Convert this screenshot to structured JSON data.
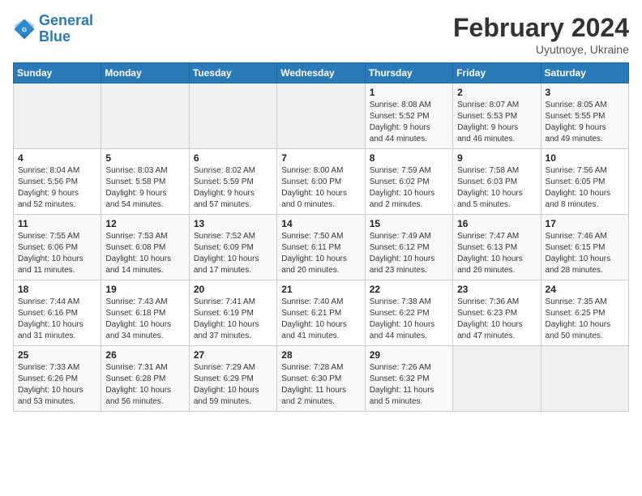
{
  "header": {
    "logo_line1": "General",
    "logo_line2": "Blue",
    "month_title": "February 2024",
    "location": "Uyutnoye, Ukraine"
  },
  "days_of_week": [
    "Sunday",
    "Monday",
    "Tuesday",
    "Wednesday",
    "Thursday",
    "Friday",
    "Saturday"
  ],
  "weeks": [
    [
      {
        "day": "",
        "info": ""
      },
      {
        "day": "",
        "info": ""
      },
      {
        "day": "",
        "info": ""
      },
      {
        "day": "",
        "info": ""
      },
      {
        "day": "1",
        "info": "Sunrise: 8:08 AM\nSunset: 5:52 PM\nDaylight: 9 hours\nand 44 minutes."
      },
      {
        "day": "2",
        "info": "Sunrise: 8:07 AM\nSunset: 5:53 PM\nDaylight: 9 hours\nand 46 minutes."
      },
      {
        "day": "3",
        "info": "Sunrise: 8:05 AM\nSunset: 5:55 PM\nDaylight: 9 hours\nand 49 minutes."
      }
    ],
    [
      {
        "day": "4",
        "info": "Sunrise: 8:04 AM\nSunset: 5:56 PM\nDaylight: 9 hours\nand 52 minutes."
      },
      {
        "day": "5",
        "info": "Sunrise: 8:03 AM\nSunset: 5:58 PM\nDaylight: 9 hours\nand 54 minutes."
      },
      {
        "day": "6",
        "info": "Sunrise: 8:02 AM\nSunset: 5:59 PM\nDaylight: 9 hours\nand 57 minutes."
      },
      {
        "day": "7",
        "info": "Sunrise: 8:00 AM\nSunset: 6:00 PM\nDaylight: 10 hours\nand 0 minutes."
      },
      {
        "day": "8",
        "info": "Sunrise: 7:59 AM\nSunset: 6:02 PM\nDaylight: 10 hours\nand 2 minutes."
      },
      {
        "day": "9",
        "info": "Sunrise: 7:58 AM\nSunset: 6:03 PM\nDaylight: 10 hours\nand 5 minutes."
      },
      {
        "day": "10",
        "info": "Sunrise: 7:56 AM\nSunset: 6:05 PM\nDaylight: 10 hours\nand 8 minutes."
      }
    ],
    [
      {
        "day": "11",
        "info": "Sunrise: 7:55 AM\nSunset: 6:06 PM\nDaylight: 10 hours\nand 11 minutes."
      },
      {
        "day": "12",
        "info": "Sunrise: 7:53 AM\nSunset: 6:08 PM\nDaylight: 10 hours\nand 14 minutes."
      },
      {
        "day": "13",
        "info": "Sunrise: 7:52 AM\nSunset: 6:09 PM\nDaylight: 10 hours\nand 17 minutes."
      },
      {
        "day": "14",
        "info": "Sunrise: 7:50 AM\nSunset: 6:11 PM\nDaylight: 10 hours\nand 20 minutes."
      },
      {
        "day": "15",
        "info": "Sunrise: 7:49 AM\nSunset: 6:12 PM\nDaylight: 10 hours\nand 23 minutes."
      },
      {
        "day": "16",
        "info": "Sunrise: 7:47 AM\nSunset: 6:13 PM\nDaylight: 10 hours\nand 26 minutes."
      },
      {
        "day": "17",
        "info": "Sunrise: 7:46 AM\nSunset: 6:15 PM\nDaylight: 10 hours\nand 28 minutes."
      }
    ],
    [
      {
        "day": "18",
        "info": "Sunrise: 7:44 AM\nSunset: 6:16 PM\nDaylight: 10 hours\nand 31 minutes."
      },
      {
        "day": "19",
        "info": "Sunrise: 7:43 AM\nSunset: 6:18 PM\nDaylight: 10 hours\nand 34 minutes."
      },
      {
        "day": "20",
        "info": "Sunrise: 7:41 AM\nSunset: 6:19 PM\nDaylight: 10 hours\nand 37 minutes."
      },
      {
        "day": "21",
        "info": "Sunrise: 7:40 AM\nSunset: 6:21 PM\nDaylight: 10 hours\nand 41 minutes."
      },
      {
        "day": "22",
        "info": "Sunrise: 7:38 AM\nSunset: 6:22 PM\nDaylight: 10 hours\nand 44 minutes."
      },
      {
        "day": "23",
        "info": "Sunrise: 7:36 AM\nSunset: 6:23 PM\nDaylight: 10 hours\nand 47 minutes."
      },
      {
        "day": "24",
        "info": "Sunrise: 7:35 AM\nSunset: 6:25 PM\nDaylight: 10 hours\nand 50 minutes."
      }
    ],
    [
      {
        "day": "25",
        "info": "Sunrise: 7:33 AM\nSunset: 6:26 PM\nDaylight: 10 hours\nand 53 minutes."
      },
      {
        "day": "26",
        "info": "Sunrise: 7:31 AM\nSunset: 6:28 PM\nDaylight: 10 hours\nand 56 minutes."
      },
      {
        "day": "27",
        "info": "Sunrise: 7:29 AM\nSunset: 6:29 PM\nDaylight: 10 hours\nand 59 minutes."
      },
      {
        "day": "28",
        "info": "Sunrise: 7:28 AM\nSunset: 6:30 PM\nDaylight: 11 hours\nand 2 minutes."
      },
      {
        "day": "29",
        "info": "Sunrise: 7:26 AM\nSunset: 6:32 PM\nDaylight: 11 hours\nand 5 minutes."
      },
      {
        "day": "",
        "info": ""
      },
      {
        "day": "",
        "info": ""
      }
    ]
  ]
}
